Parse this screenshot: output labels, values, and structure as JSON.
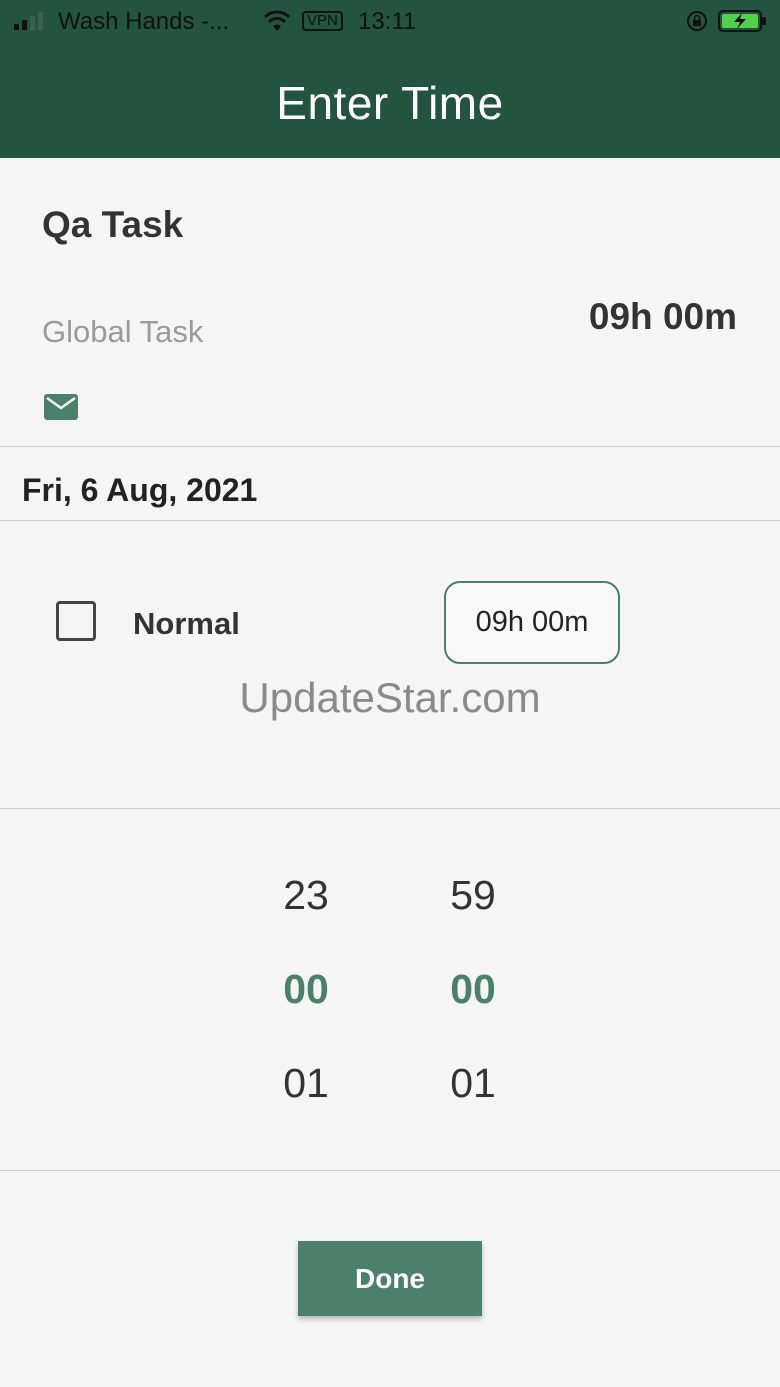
{
  "status_bar": {
    "carrier": "Wash Hands -...",
    "vpn": "VPN",
    "time": "13:11",
    "icons": [
      "signal-icon",
      "wifi-icon",
      "rotation-lock-icon",
      "battery-charging-icon"
    ]
  },
  "app_bar": {
    "title": "Enter Time"
  },
  "task": {
    "name": "Qa Task",
    "type": "Global Task",
    "total": "09h 00m",
    "icon": "mail-icon"
  },
  "date": "Fri, 6 Aug, 2021",
  "entry": {
    "checked": false,
    "label": "Normal",
    "time": "09h 00m"
  },
  "watermark": "UpdateStar.com",
  "picker": {
    "hours": {
      "prev": "23",
      "selected": "00",
      "next": "01"
    },
    "minutes": {
      "prev": "59",
      "selected": "00",
      "next": "01"
    }
  },
  "done_label": "Done",
  "colors": {
    "primary_dark": "#235440",
    "accent": "#4b816b"
  }
}
